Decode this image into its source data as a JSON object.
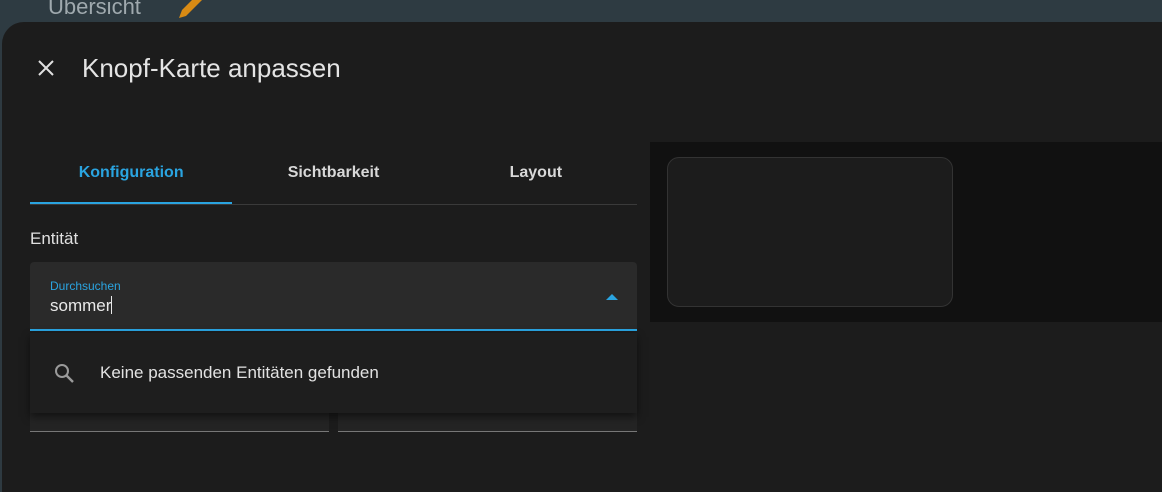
{
  "header": {
    "title": "Übersicht"
  },
  "dialog": {
    "title": "Knopf-Karte anpassen",
    "tabs": [
      {
        "label": "Konfiguration",
        "active": true
      },
      {
        "label": "Sichtbarkeit"
      },
      {
        "label": "Layout"
      }
    ],
    "entity_label": "Entität",
    "search": {
      "label": "Durchsuchen",
      "value": "sommer"
    },
    "dropdown": {
      "empty_text": "Keine passenden Entitäten gefunden"
    }
  },
  "colors": {
    "accent": "#2aa4e0",
    "background": "#1c1c1c",
    "edit_icon": "#d98b14"
  }
}
